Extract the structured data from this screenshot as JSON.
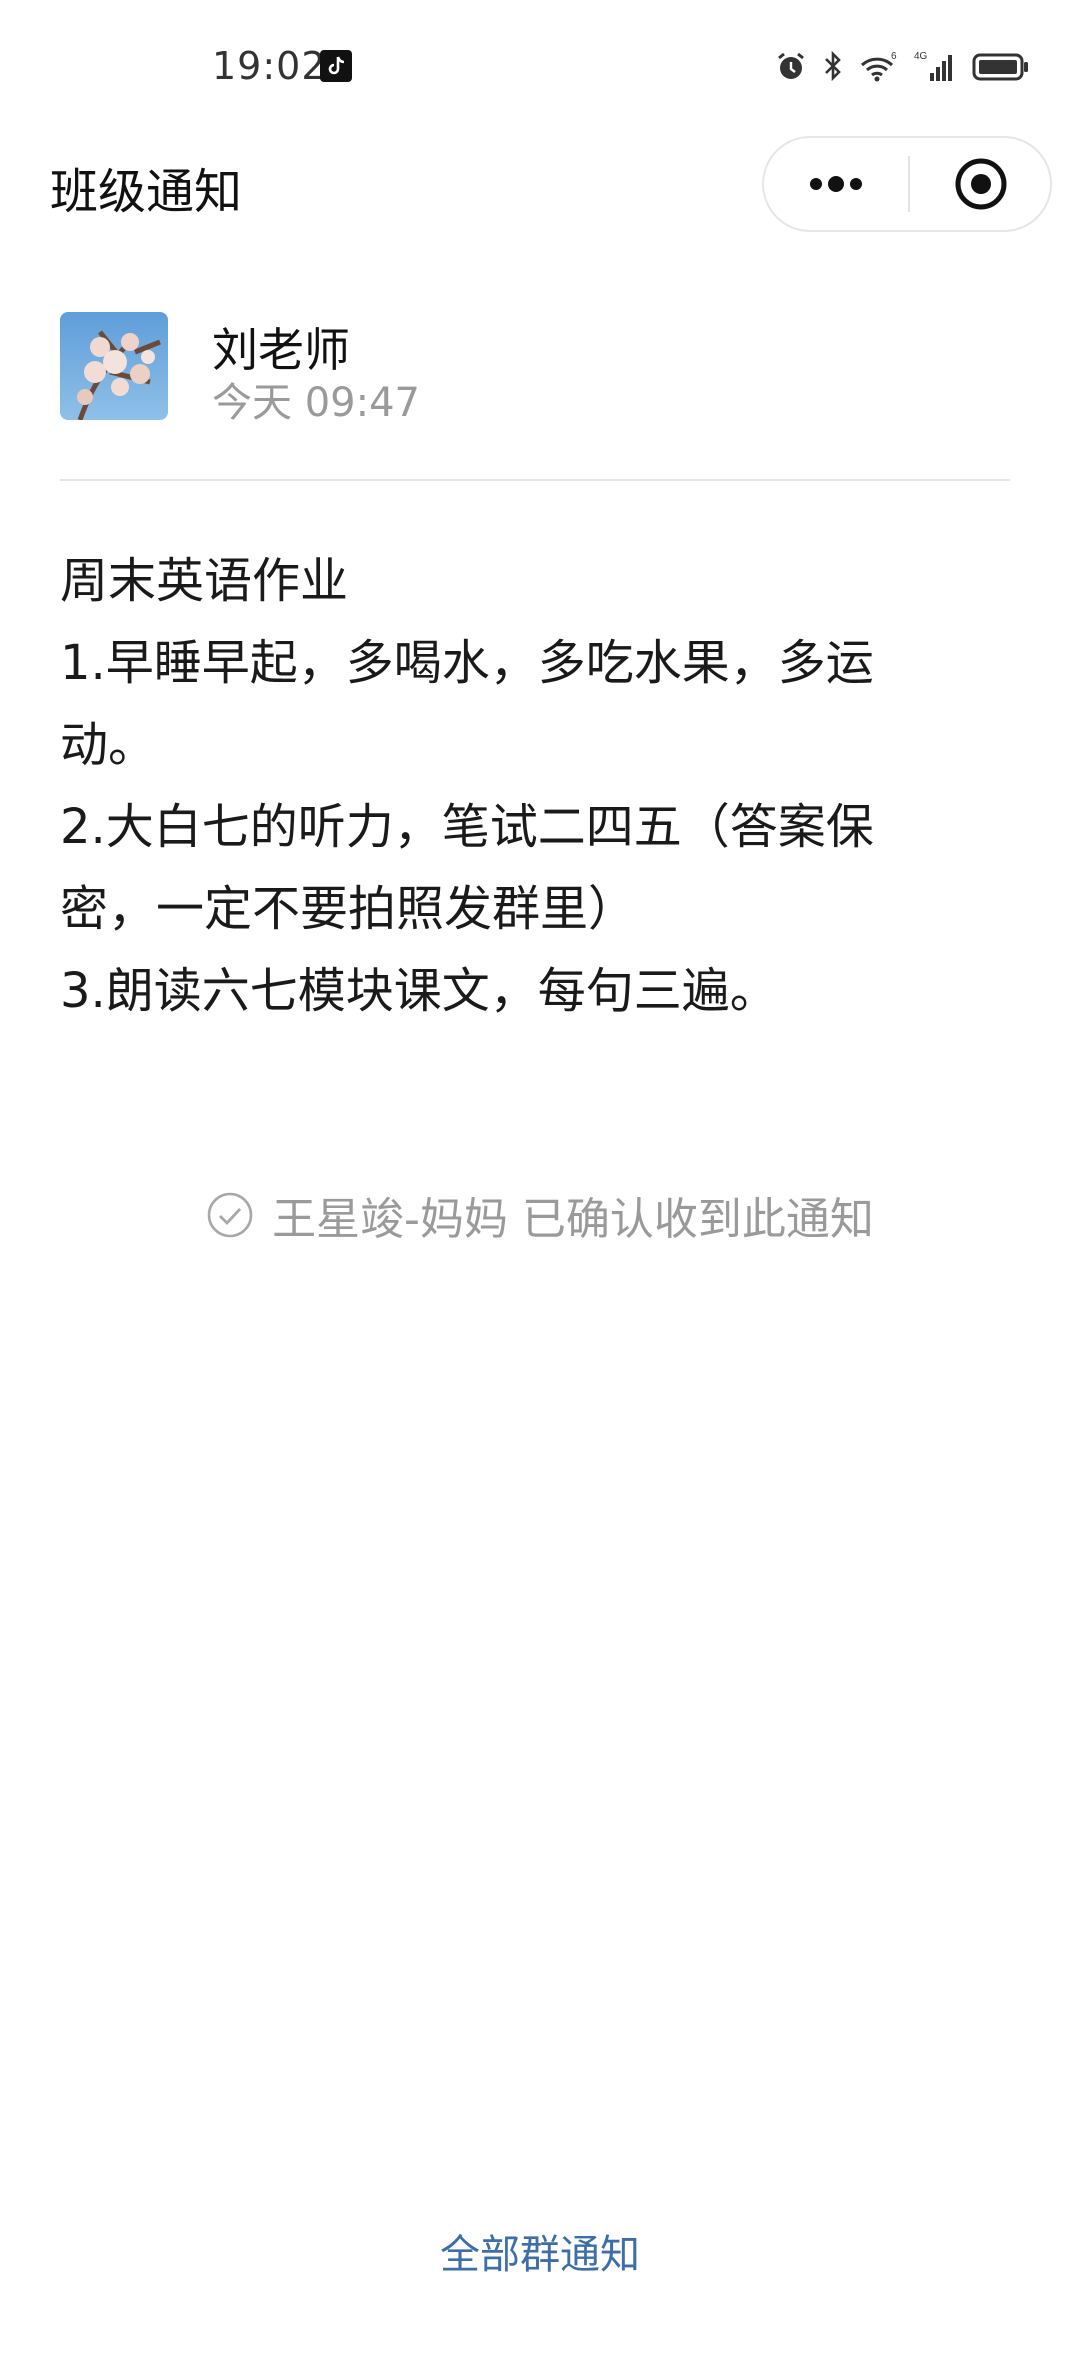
{
  "status_bar": {
    "time": "19:02",
    "icons": [
      "tiktok-icon",
      "alarm-icon",
      "bluetooth-icon",
      "wifi-6-icon",
      "signal-4g-icon",
      "battery-icon"
    ],
    "wifi_label": "6",
    "network_label": "4G"
  },
  "header": {
    "title": "班级通知",
    "capsule": {
      "more_icon": "more-dots-icon",
      "close_icon": "target-close-icon"
    }
  },
  "sender": {
    "name": "刘老师",
    "time": "今天 09:47"
  },
  "notice": {
    "lines": [
      "周末英语作业",
      "1.早睡早起，多喝水，多吃水果，多运动。",
      "2.大白七的听力，笔试二四五（答案保密，一定不要拍照发群里）",
      "3.朗读六七模块课文，每句三遍。"
    ]
  },
  "confirmation": {
    "text": "王星竣-妈妈 已确认收到此通知",
    "icon": "check-circle-icon"
  },
  "footer": {
    "all_notices_label": "全部群通知"
  },
  "colors": {
    "link": "#3d6ea8",
    "muted_text": "#9a9a9a",
    "divider": "#e5e5e5"
  }
}
